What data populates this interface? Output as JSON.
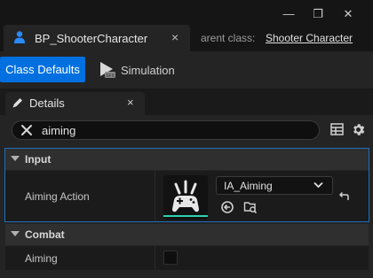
{
  "window": {
    "minimize_glyph": "—",
    "maximize_glyph": "❐",
    "close_glyph": "✕"
  },
  "document_tab": {
    "label": "BP_ShooterCharacter",
    "icon": "blueprint-person-icon",
    "close_glyph": "×"
  },
  "parent_class": {
    "label": "arent class:",
    "value": "Shooter Character"
  },
  "toolbar": {
    "class_defaults_label": "Class Defaults",
    "simulation_label": "Simulation"
  },
  "details": {
    "tab_label": "Details",
    "tab_close_glyph": "×",
    "search_value": "aiming"
  },
  "categories": [
    {
      "label": "Input",
      "properties": [
        {
          "name": "Aiming Action",
          "value": "IA_Aiming",
          "thumbnail_icon": "input-action-gamepad-icon"
        }
      ]
    },
    {
      "label": "Combat",
      "properties": [
        {
          "name": "Aiming",
          "checked": false
        }
      ]
    }
  ],
  "colors": {
    "accent_blue": "#0070e0",
    "selection_outline": "#1e6fbf",
    "asset_underline": "#2fd1b0",
    "panel_bg": "#242424",
    "row_bg": "#1b1b1b"
  }
}
